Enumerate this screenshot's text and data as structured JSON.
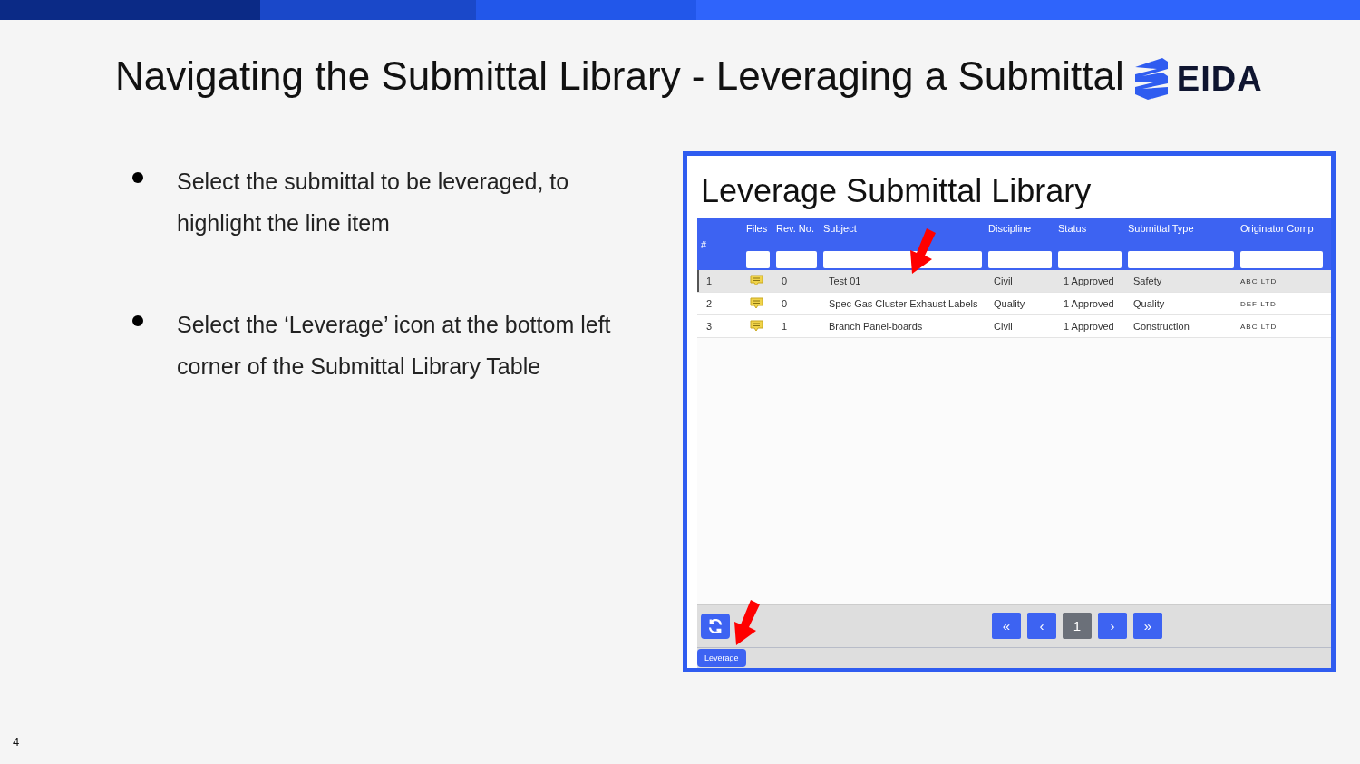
{
  "slide": {
    "title": "Navigating the Submittal Library - Leveraging a Submittal",
    "logo": "EIDA",
    "page_number": "4"
  },
  "bullets": [
    "Select the submittal to be leveraged, to highlight the line item",
    "Select the ‘Leverage’ icon at the bottom left corner of the Submittal Library Table"
  ],
  "library": {
    "title": "Leverage Submittal Library",
    "columns": [
      {
        "label": "#",
        "filter": false
      },
      {
        "label": "Files",
        "filter": true
      },
      {
        "label": "Rev. No.",
        "filter": true
      },
      {
        "label": "Subject",
        "filter": true
      },
      {
        "label": "Discipline",
        "filter": true
      },
      {
        "label": "Status",
        "filter": true
      },
      {
        "label": "Submittal Type",
        "filter": true
      },
      {
        "label": "Originator Comp",
        "filter": true
      }
    ],
    "rows": [
      {
        "selected": true,
        "cells": [
          "1",
          "",
          "0",
          "Test 01",
          "Civil",
          "1 Approved",
          "Safety",
          "ABC LTD"
        ]
      },
      {
        "selected": false,
        "cells": [
          "2",
          "",
          "0",
          "Spec Gas Cluster Exhaust Labels",
          "Quality",
          "1 Approved",
          "Quality",
          "DEF LTD"
        ]
      },
      {
        "selected": false,
        "cells": [
          "3",
          "",
          "1",
          "Branch Panel-boards",
          "Civil",
          "1 Approved",
          "Construction",
          "ABC LTD"
        ]
      }
    ],
    "pager": [
      {
        "label": "«",
        "selected": false
      },
      {
        "label": "‹",
        "selected": false
      },
      {
        "label": "1",
        "selected": true
      },
      {
        "label": "›",
        "selected": false
      },
      {
        "label": "»",
        "selected": false
      }
    ],
    "leverage_button": "Leverage"
  }
}
